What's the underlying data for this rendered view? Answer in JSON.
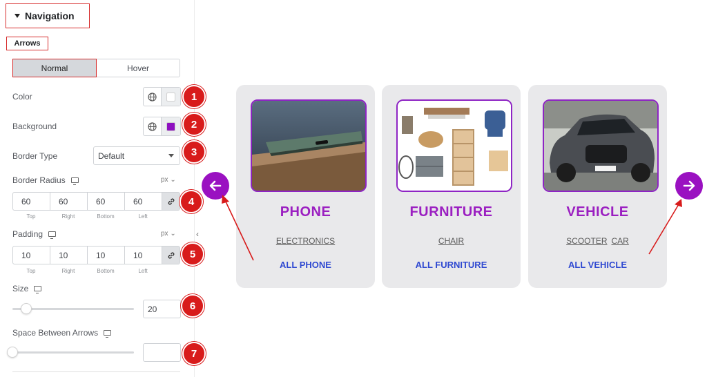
{
  "panel": {
    "section_title": "Navigation",
    "subsection": "Arrows",
    "tabs": [
      {
        "label": "Normal",
        "active": true
      },
      {
        "label": "Hover",
        "active": false
      }
    ],
    "color": {
      "label": "Color",
      "value": "#ffffff"
    },
    "background": {
      "label": "Background",
      "value": "#8e10c0"
    },
    "border_type": {
      "label": "Border Type",
      "value": "Default"
    },
    "border_radius": {
      "label": "Border Radius",
      "unit": "px",
      "values": [
        "60",
        "60",
        "60",
        "60"
      ],
      "sides": [
        "Top",
        "Right",
        "Bottom",
        "Left"
      ]
    },
    "padding": {
      "label": "Padding",
      "unit": "px",
      "values": [
        "10",
        "10",
        "10",
        "10"
      ],
      "sides": [
        "Top",
        "Right",
        "Bottom",
        "Left"
      ]
    },
    "size": {
      "label": "Size",
      "value": "20"
    },
    "space_between": {
      "label": "Space Between Arrows",
      "value": ""
    },
    "badges": [
      "1",
      "2",
      "3",
      "4",
      "5",
      "6",
      "7"
    ],
    "collapse_glyph": "‹"
  },
  "cards": [
    {
      "name": "PHONE",
      "tags": [
        "ELECTRONICS"
      ],
      "link": "ALL PHONE",
      "image": "phone-photo"
    },
    {
      "name": "FURNITURE",
      "tags": [
        "CHAIR"
      ],
      "link": "ALL FURNITURE",
      "image": "furniture-photo"
    },
    {
      "name": "VEHICLE",
      "tags": [
        "SCOOTER",
        "CAR"
      ],
      "link": "ALL VEHICLE",
      "image": "car-photo"
    }
  ],
  "colors": {
    "accent": "#9a11c1",
    "annotation": "#d81b1b",
    "link": "#2f49d1"
  }
}
